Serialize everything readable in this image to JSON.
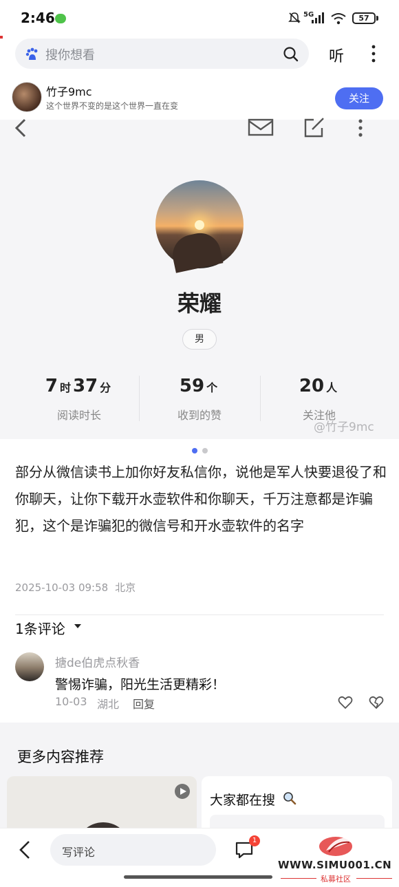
{
  "status_bar": {
    "time": "2:46",
    "network": "5G",
    "battery": "57"
  },
  "search": {
    "placeholder": "搜你想看",
    "listen_label": "听"
  },
  "author": {
    "name": "竹子9mc",
    "bio": "这个世界不变的是这个世界一直在变",
    "follow_label": "关注"
  },
  "profile": {
    "name": "荣耀",
    "gender": "男",
    "stats": [
      {
        "value_parts": [
          "7",
          "时",
          "37",
          "分"
        ],
        "label": "阅读时长"
      },
      {
        "value_parts": [
          "59",
          "个"
        ],
        "label": "收到的赞"
      },
      {
        "value_parts": [
          "20",
          "人"
        ],
        "label": "关注他"
      }
    ],
    "watermark": "@竹子9mc"
  },
  "post": {
    "text": "部分从微信读书上加你好友私信你，说他是军人快要退役了和你聊天，让你下载开水壶软件和你聊天，千万注意都是诈骗犯，这个是诈骗犯的微信号和开水壶软件的名字",
    "datetime": "2025-10-03 09:58",
    "location": "北京"
  },
  "comments": {
    "header": "1条评论",
    "items": [
      {
        "author": "搪de伯虎点秋香",
        "text": "警惕诈骗，阳光生活更精彩！",
        "date": "10-03",
        "location": "湖北",
        "reply_label": "回复"
      }
    ]
  },
  "recommendations": {
    "title": "更多内容推荐",
    "search_card_title": "大家都在搜"
  },
  "bottom_bar": {
    "comment_placeholder": "写评论",
    "comment_count": "1"
  },
  "site_watermark": {
    "url": "WWW.SIMU001.CN",
    "subtitle": "私募社区"
  },
  "colors": {
    "accent": "#4e6ef2",
    "badge": "#f44336"
  }
}
